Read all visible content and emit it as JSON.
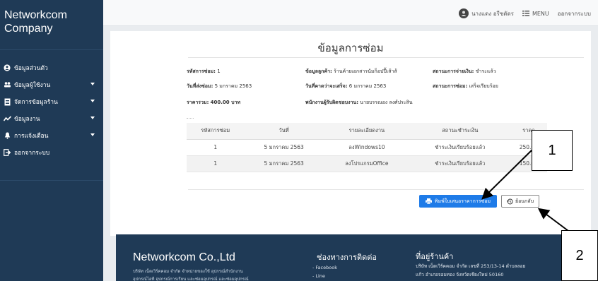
{
  "sidebar": {
    "brand_line1": "Networkcom",
    "brand_line2": "Company",
    "items": [
      {
        "label": "ข้อมูลส่วนตัว",
        "icon": "user-circle-icon",
        "has_caret": false
      },
      {
        "label": "ข้อมูลผู้ใช้งาน",
        "icon": "users-icon",
        "has_caret": true
      },
      {
        "label": "จัดการข้อมูลร้าน",
        "icon": "document-icon",
        "has_caret": true
      },
      {
        "label": "ข้อมูลงาน",
        "icon": "chart-line-icon",
        "has_caret": true
      },
      {
        "label": "การแจ้งเตือน",
        "icon": "bell-icon",
        "has_caret": true
      },
      {
        "label": "ออกจากระบบ",
        "icon": "sign-out-icon",
        "has_caret": false
      }
    ]
  },
  "topbar": {
    "user_name": "นางแดง อรีชตัดร",
    "menu_label": "MENU",
    "logout_label": "ออกจากระบบ"
  },
  "page": {
    "title": "ข้อมูลการซ่อม",
    "info": {
      "repair_id_label": "รหัสการซ่อม:",
      "repair_id_value": "1",
      "customer_label": "ข้อมูลลูกค้า:",
      "customer_value": "ร้านค้ายเอกสารนัมก็อปปี้เส้าส้",
      "payment_status_label": "สถานะการจ่ายเงิน:",
      "payment_status_value": "ชำระแล้ว",
      "send_date_label": "วันที่ส่งซ่อม:",
      "send_date_value": "5 มกราคม 2563",
      "expected_date_label": "วันที่คาดว่าจะเสร็จ:",
      "expected_date_value": "6 มกราคม 2563",
      "repair_status_label": "สถานะการซ่อม:",
      "repair_status_value": "เสร็จเรียบร้อย",
      "total_label": "ราคารวม:",
      "total_value": "400.00 บาท",
      "staff_label": "พนักงานผู้รับผิดชอบงาน:",
      "staff_value": "นายบรรณอง ลงศ์ประสิน"
    },
    "table": {
      "headers": [
        "รหัสการซ่อม",
        "วันที่",
        "รายละเอียดงาน",
        "สถานะชำระเงิน",
        "ราคา"
      ],
      "rows": [
        [
          "1",
          "5 มกราคม 2563",
          "ลงWindows10",
          "ชำระเงินเรียบร้อยแล้ว",
          "250.00"
        ],
        [
          "1",
          "5 มกราคม 2563",
          "ลงโปรแกรมOffice",
          "ชำระเงินเรียบร้อยแล้ว",
          "150.00"
        ]
      ]
    },
    "print_button": "พิมพ์ใบเสนอราคาการซ่อม",
    "back_button": "ย้อนกลับ"
  },
  "footer": {
    "company": "Networkcom Co.,Ltd",
    "about_line1": "บริษัท เน็ตเวิร์คคอม จำกัด จำหน่ายของใช้ อุปกรณ์สำนักงาน",
    "about_line2": "อุปกรณ์ไอที อุปกรณ์การเรียน และซ่อมอุปกรณ์ และซ่อมอุปกรณ์",
    "channels_title": "ช่องทางการติดต่อ",
    "channels": [
      "- Facebook",
      "- Line"
    ],
    "shop_title": "ที่อยู่ร้านค้า",
    "address_line1": "บริษัท เน็ตเวิร์คคอม จำกัด เลขที่ 253/13-14 ตำบลลอย",
    "address_line2": "แก้ว อำเภอจอมทอง จังหวัดเชียงใหม่ 50160"
  },
  "callouts": [
    "1",
    "2"
  ]
}
